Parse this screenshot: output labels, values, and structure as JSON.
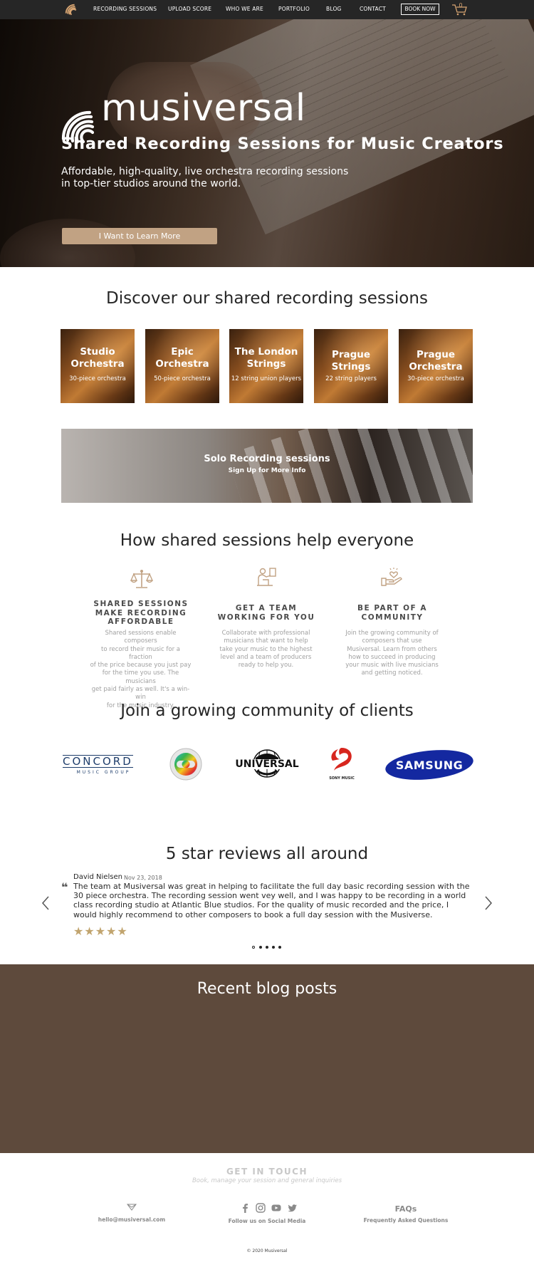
{
  "nav": {
    "links": [
      "RECORDING SESSIONS",
      "UPLOAD SCORE",
      "WHO WE ARE",
      "PORTFOLIO",
      "BLOG",
      "CONTACT"
    ],
    "book_now": "BOOK NOW",
    "cart_count": "0"
  },
  "hero": {
    "brand": "musiversal",
    "title": "Shared Recording Sessions for Music Creators",
    "subtitle_line1": "Affordable, high-quality, live orchestra recording sessions",
    "subtitle_line2": "in top-tier studios around the world.",
    "cta": "I Want to Learn More"
  },
  "discover": {
    "title": "Discover our shared recording sessions",
    "cards": [
      {
        "title_line1": "Studio",
        "title_line2": "Orchestra",
        "subtitle": "30-piece orchestra"
      },
      {
        "title_line1": "Epic",
        "title_line2": "Orchestra",
        "subtitle": "50-piece orchestra"
      },
      {
        "title_line1": "The London",
        "title_line2": "Strings",
        "subtitle": "12 string union players"
      },
      {
        "title_line1": "Prague",
        "title_line2": "Strings",
        "subtitle": "22 string players"
      },
      {
        "title_line1": "Prague",
        "title_line2": "Orchestra",
        "subtitle": "30-piece orchestra"
      }
    ],
    "solo": {
      "title": "Solo Recording sessions",
      "subtitle": "Sign Up for More Info"
    }
  },
  "how": {
    "title": "How shared sessions help everyone",
    "features": [
      {
        "icon": "scale-icon",
        "title_lines": [
          "SHARED SESSIONS",
          "MAKE RECORDING",
          "AFFORDABLE"
        ],
        "text_lines": [
          "Shared sessions enable composers",
          "to record their music for a fraction",
          "of the price because you just pay",
          "for the time you use. The musicians",
          "get paid fairly as well. It's a win-win",
          "for the music industry."
        ]
      },
      {
        "icon": "composer-icon",
        "title_lines": [
          "GET A TEAM",
          "WORKING FOR YOU"
        ],
        "text_lines": [
          "Collaborate with professional",
          "musicians that want to help",
          "take your music to the highest",
          "level and a team of producers",
          "ready to help you."
        ]
      },
      {
        "icon": "heart-hand-icon",
        "title_lines": [
          "BE PART OF A",
          "COMMUNITY"
        ],
        "text_lines": [
          "Join the growing community of",
          "composers that use",
          "Musiversal. Learn from others",
          "how to succeed in producing",
          "your music with live musicians",
          "and getting noticed."
        ]
      }
    ]
  },
  "clients": {
    "title": "Join a growing community of clients",
    "logos": {
      "concord": "CONCORD",
      "concord_sub": "MUSIC GROUP",
      "universal": "UNIVERSAL",
      "sony": "SONY MUSIC",
      "samsung": "SAMSUNG"
    }
  },
  "reviews": {
    "title": "5 star reviews all around",
    "name": "David Nielsen",
    "date": "Nov 23, 2018",
    "text": "The team at Musiversal was great in helping to facilitate the full day basic recording session with the 30 piece orchestra.  The recording session went vey well, and I was happy to be recording in a world class recording studio at Atlantic Blue studios.  For the quality of music recorded and the price, I would highly recommend to other composers to book a full day session with the Musiverse.",
    "stars": "★★★★★",
    "rating": 5
  },
  "blog": {
    "title": "Recent blog posts"
  },
  "footer": {
    "get_in_touch": "GET IN TOUCH",
    "get_in_touch_sub": "Book, manage your session and general inquiries",
    "email": "hello@musiversal.com",
    "social_label": "Follow us on Social Media",
    "faqs": "FAQs",
    "faqs_sub": "Frequently Asked Questions",
    "copyright": "© 2020 Musiversal"
  },
  "colors": {
    "accent": "#c1a283",
    "nav_bg": "#262626",
    "blog_bg": "#5e4a3c"
  }
}
